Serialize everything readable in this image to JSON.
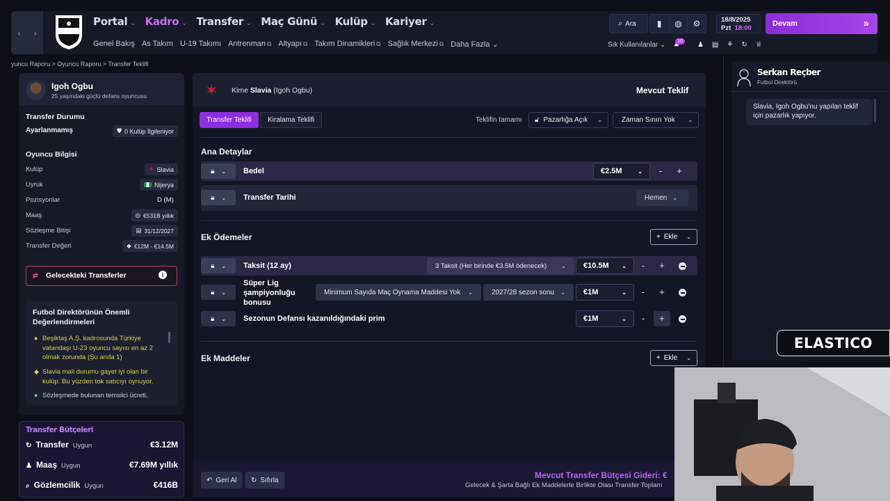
{
  "nav": {
    "main": [
      {
        "label": "Portal",
        "active": false
      },
      {
        "label": "Kadro",
        "active": true
      },
      {
        "label": "Transfer",
        "active": false
      },
      {
        "label": "Maç Günü",
        "active": false
      },
      {
        "label": "Kulüp",
        "active": false
      },
      {
        "label": "Kariyer",
        "active": false
      }
    ],
    "sub": [
      "Genel Bakış",
      "As Takım",
      "U-19 Takımı",
      "Antrenman",
      "Altyapı",
      "Takım Dinamikleri",
      "Sağlık Merkezi",
      "Daha Fazla"
    ],
    "search_label": "Ara",
    "date": "18/8/2025",
    "day": "Pzt",
    "time": "18:00",
    "continue_label": "Devam",
    "quick_label": "Sık Kullanılanlar",
    "badge": "10"
  },
  "breadcrumb": "yuncu Raporu  >  Oyuncu Raporu  >  Transfer Teklifi",
  "player": {
    "name": "Igoh Ogbu",
    "desc": "25 yaşındaki güçlü defans oyuncusu",
    "transfer_status_title": "Transfer Durumu",
    "transfer_status": "Ayarlanmamış",
    "clubs_interested": "0 Kulüp İlgileniyor",
    "info_title": "Oyuncu Bilgisi",
    "rows": [
      {
        "label": "Kulüp",
        "value": "Slavia"
      },
      {
        "label": "Uyruk",
        "value": "Nijerya"
      },
      {
        "label": "Pozisyonlar",
        "value": "D (M)"
      },
      {
        "label": "Maaş",
        "value": "€531B yıllık"
      },
      {
        "label": "Sözleşme Bitişi",
        "value": "31/12/2027"
      },
      {
        "label": "Transfer Değeri",
        "value": "€12M - €14.5M"
      }
    ],
    "future_transfers": "Gelecekteki Transferler",
    "director_title": "Futbol Direktörünün Önemli Değerlendirmeleri",
    "director_items": [
      "Beşiktaş A.Ş. kadrosunda Türkiye vatandaşı U-23 oyuncu sayısı en az 2 olmak zorunda (Şu anda 1)",
      "Slavia mali durumu gayet iyi olan bir kulüp. Bu yüzden tok satıcıyı oynuyor.",
      "Sözleşmede bulunan temsilci ücreti,"
    ]
  },
  "budget": {
    "title": "Transfer Bütçeleri",
    "rows": [
      {
        "label": "Transfer",
        "status": "Uygun",
        "value": "€3.12M"
      },
      {
        "label": "Maaş",
        "status": "Uygun",
        "value": "€7.69M yıllık"
      },
      {
        "label": "Gözlemcilik",
        "status": "Uygun",
        "value": "€416B"
      }
    ]
  },
  "offer": {
    "to_prefix": "Kime",
    "club": "Slavia",
    "player_paren": "(Igoh Ogbu)",
    "current_offer": "Mevcut Teklif",
    "tabs": [
      "Transfer Teklifi",
      "Kiralama Teklifi"
    ],
    "completion_label": "Teklifin tamamı",
    "negotiation": "Pazarlığa Açık",
    "deadline": "Zaman Sınırı Yok",
    "main_title": "Ana Detaylar",
    "fee_label": "Bedel",
    "fee_value": "€2.5M",
    "date_label": "Transfer Tarihi",
    "date_value": "Hemen",
    "extra_title": "Ek Ödemeler",
    "add_label": "Ekle",
    "installment_label": "Taksit (12 ay)",
    "installment_desc": "3 Taksit (Her birinde €3.5M ödenecek)",
    "installment_value": "€10.5M",
    "league_label": "Süper Lig şampiyonluğu bonusu",
    "league_condition": "Minimum Sayıda Maç Oynama Maddesi Yok",
    "league_season": "2027/28 sezon sonu",
    "league_value": "€1M",
    "defense_label": "Sezonun Defansı kazanıldığındaki prim",
    "defense_value": "€1M",
    "clauses_title": "Ek Maddeler",
    "undo_label": "Geri Al",
    "reset_label": "Sıfırla",
    "footer_title": "Mevcut Transfer Bütçesi Gideri: €",
    "footer_sub": "Gelecek & Şarta Bağlı Ek Maddelerle Birlikte Olası Transfer Toplam"
  },
  "director": {
    "name": "Serkan Reçber",
    "role": "Futbol Direktörü",
    "message": "Slavia, Igoh Ogbu'nu yapılan teklif için pazarlık yapıyor."
  },
  "overlay": {
    "brand": "ELASTICO"
  }
}
